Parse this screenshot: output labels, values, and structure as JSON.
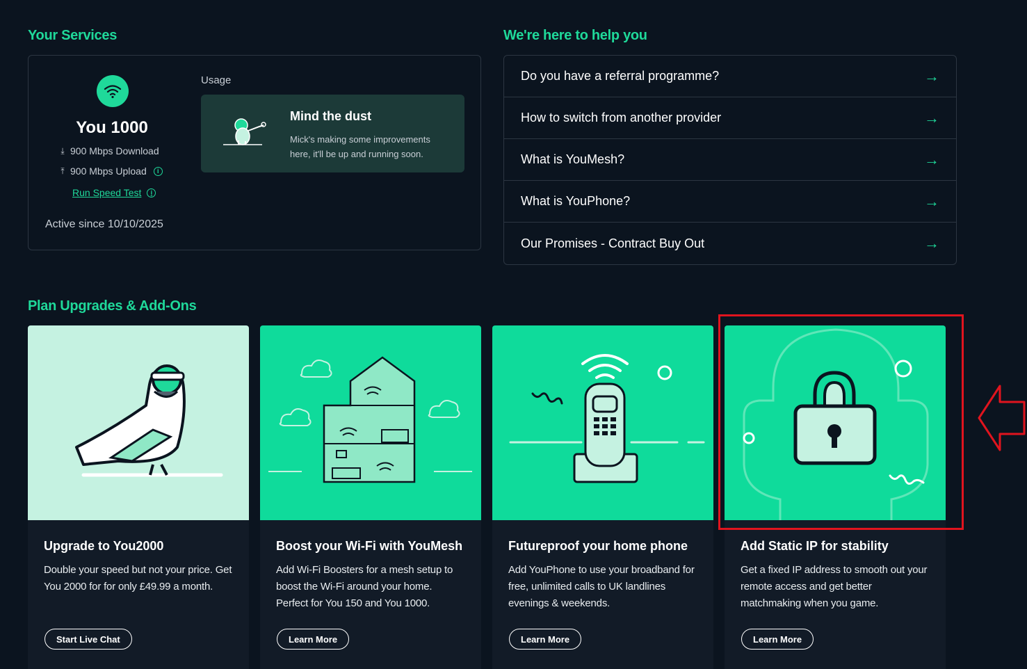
{
  "services": {
    "title": "Your Services",
    "plan_name": "You 1000",
    "download": "900 Mbps Download",
    "upload": "900 Mbps Upload",
    "speed_test": "Run Speed Test",
    "active_since": "Active since 10/10/2025",
    "usage_label": "Usage",
    "dust_title": "Mind the dust",
    "dust_text": "Mick's making some improvements here, it'll be up and running soon."
  },
  "help": {
    "title": "We're here to help you",
    "items": [
      {
        "label": "Do you have a referral programme?"
      },
      {
        "label": "How to switch from another provider"
      },
      {
        "label": "What is YouMesh?"
      },
      {
        "label": "What is YouPhone?"
      },
      {
        "label": "Our Promises - Contract Buy Out"
      }
    ]
  },
  "addons": {
    "title": "Plan Upgrades & Add-Ons",
    "cards": [
      {
        "title": "Upgrade to You2000",
        "text": "Double your speed but not your price. Get You 2000 for for only £49.99 a month.",
        "button": "Start Live Chat",
        "bg": "#c5f2e1"
      },
      {
        "title": "Boost your Wi-Fi with YouMesh",
        "text": "Add Wi-Fi Boosters for a mesh setup to boost the Wi-Fi around your home. Perfect for You 150 and You 1000.",
        "button": "Learn More",
        "bg": "#0fdb9b"
      },
      {
        "title": "Futureproof your home phone",
        "text": "Add YouPhone to use your broadband for free, unlimited calls to UK landlines evenings & weekends.",
        "button": "Learn More",
        "bg": "#0fdb9b"
      },
      {
        "title": "Add Static IP for stability",
        "text": "Get a fixed IP address to smooth out your remote access and get better matchmaking when you game.",
        "button": "Learn More",
        "bg": "#0fdb9b"
      }
    ]
  },
  "colors": {
    "accent": "#1fd99a",
    "background": "#0b141f",
    "highlight": "#e0141e"
  }
}
